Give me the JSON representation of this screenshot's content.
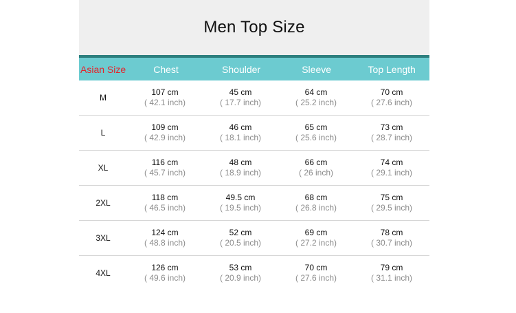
{
  "title": "Men Top Size",
  "headers": {
    "size": "Asian Size",
    "chest": "Chest",
    "shoulder": "Shoulder",
    "sleeve": "Sleeve",
    "length": "Top Length"
  },
  "rows": [
    {
      "size": "M",
      "chest_cm": "107 cm",
      "chest_in": "( 42.1 inch)",
      "shoulder_cm": "45 cm",
      "shoulder_in": "( 17.7 inch)",
      "sleeve_cm": "64 cm",
      "sleeve_in": "( 25.2 inch)",
      "length_cm": "70 cm",
      "length_in": "( 27.6 inch)"
    },
    {
      "size": "L",
      "chest_cm": "109 cm",
      "chest_in": "( 42.9 inch)",
      "shoulder_cm": "46 cm",
      "shoulder_in": "( 18.1 inch)",
      "sleeve_cm": "65 cm",
      "sleeve_in": "( 25.6 inch)",
      "length_cm": "73 cm",
      "length_in": "( 28.7 inch)"
    },
    {
      "size": "XL",
      "chest_cm": "116 cm",
      "chest_in": "( 45.7 inch)",
      "shoulder_cm": "48 cm",
      "shoulder_in": "( 18.9 inch)",
      "sleeve_cm": "66 cm",
      "sleeve_in": "( 26 inch)",
      "length_cm": "74 cm",
      "length_in": "( 29.1 inch)"
    },
    {
      "size": "2XL",
      "chest_cm": "118 cm",
      "chest_in": "( 46.5 inch)",
      "shoulder_cm": "49.5 cm",
      "shoulder_in": "( 19.5 inch)",
      "sleeve_cm": "68 cm",
      "sleeve_in": "( 26.8 inch)",
      "length_cm": "75 cm",
      "length_in": "( 29.5 inch)"
    },
    {
      "size": "3XL",
      "chest_cm": "124 cm",
      "chest_in": "( 48.8 inch)",
      "shoulder_cm": "52 cm",
      "shoulder_in": "( 20.5 inch)",
      "sleeve_cm": "69 cm",
      "sleeve_in": "( 27.2 inch)",
      "length_cm": "78 cm",
      "length_in": "( 30.7 inch)"
    },
    {
      "size": "4XL",
      "chest_cm": "126 cm",
      "chest_in": "( 49.6 inch)",
      "shoulder_cm": "53 cm",
      "shoulder_in": "( 20.9 inch)",
      "sleeve_cm": "70 cm",
      "sleeve_in": "( 27.6 inch)",
      "length_cm": "79 cm",
      "length_in": "( 31.1 inch)"
    }
  ],
  "colors": {
    "header_bg": "#6ccbd0",
    "header_border": "#2d7f7e",
    "size_header_text": "#e4232b",
    "title_bg": "#efefef"
  }
}
